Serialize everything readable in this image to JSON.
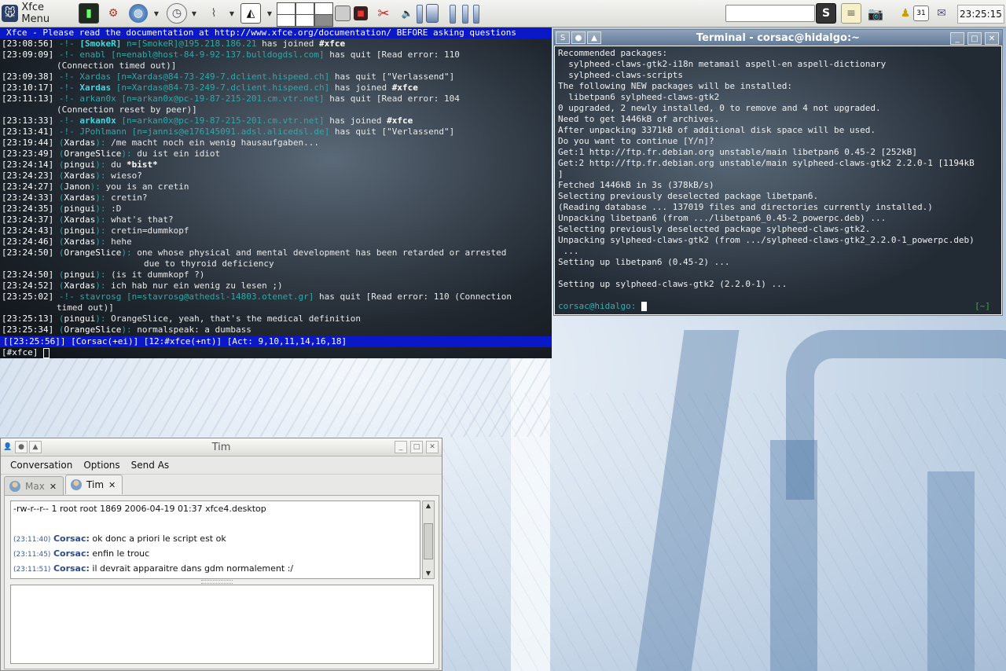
{
  "panel": {
    "menu_label": "Xfce Menu",
    "clock": "23:25:15",
    "icons": [
      "terminal-icon",
      "settings-manager-icon",
      "web-browser-icon",
      "clock-timer-icon",
      "mouse-icon",
      "inkscape-icon",
      "workspace-switcher",
      "window-list-icon",
      "screenshot-icon",
      "cut-icon",
      "mixer-icon",
      "battery-icon",
      "cpu-monitor-icon",
      "search-entry",
      "search-button-icon",
      "notes-icon",
      "camera-icon",
      "user-icon",
      "calendar-icon",
      "mail-icon"
    ]
  },
  "irc": {
    "topic": "Xfce - Please read the documentation at http://www.xfce.org/documentation/ BEFORE asking questions",
    "lines": [
      {
        "ts": "[23:08:56]",
        "kind": "join",
        "nick": "[SmokeR]",
        "host": "n=[SmokeR]@195.218.186.21",
        "msg": "has joined",
        "chan": "#xfce"
      },
      {
        "ts": "[23:09:09]",
        "kind": "quit",
        "nick": "enabl",
        "host": "[n=enabl@host-84-9-92-137.bulldogdsl.com]",
        "msg": "has quit [Read error: 110",
        "cont": "(Connection timed out)]"
      },
      {
        "ts": "[23:09:38]",
        "kind": "quit",
        "nick": "Xardas",
        "host": "[n=Xardas@84-73-249-7.dclient.hispeed.ch]",
        "msg": "has quit [\"Verlassend\"]"
      },
      {
        "ts": "[23:10:17]",
        "kind": "join",
        "nick": "Xardas",
        "host": "[n=Xardas@84-73-249-7.dclient.hispeed.ch]",
        "msg": "has joined",
        "chan": "#xfce"
      },
      {
        "ts": "[23:11:13]",
        "kind": "quit",
        "nick": "arkan0x",
        "host": "[n=arkan0x@pc-19-87-215-201.cm.vtr.net]",
        "msg": "has quit [Read error: 104",
        "cont": "(Connection reset by peer)]"
      },
      {
        "ts": "[23:13:33]",
        "kind": "join",
        "nick": "arkan0x",
        "host": "[n=arkan0x@pc-19-87-215-201.cm.vtr.net]",
        "msg": "has joined",
        "chan": "#xfce"
      },
      {
        "ts": "[23:13:41]",
        "kind": "quit",
        "nick": "JPohlmann",
        "host": "[n=jannis@e176145091.adsl.alicedsl.de]",
        "msg": "has quit [\"Verlassend\"]"
      },
      {
        "ts": "[23:19:44]",
        "kind": "msg",
        "nick": "Xardas",
        "text": "/me macht noch ein wenig hausaufgaben..."
      },
      {
        "ts": "[23:23:49]",
        "kind": "msg",
        "nick": "OrangeSlice",
        "text": "du ist ein idiot"
      },
      {
        "ts": "[23:24:14]",
        "kind": "msg",
        "nick": "pingui",
        "text": "du *bist*"
      },
      {
        "ts": "[23:24:23]",
        "kind": "msg",
        "nick": "Xardas",
        "text": "wieso?"
      },
      {
        "ts": "[23:24:27]",
        "kind": "msg",
        "nick": "Janon",
        "text": "you is an cretin"
      },
      {
        "ts": "[23:24:33]",
        "kind": "msg",
        "nick": "Xardas",
        "text": "cretin?"
      },
      {
        "ts": "[23:24:35]",
        "kind": "msg",
        "nick": "pingui",
        "text": ":D"
      },
      {
        "ts": "[23:24:37]",
        "kind": "msg",
        "nick": "Xardas",
        "text": "what's that?"
      },
      {
        "ts": "[23:24:43]",
        "kind": "msg",
        "nick": "pingui",
        "text": "cretin=dummkopf"
      },
      {
        "ts": "[23:24:46]",
        "kind": "msg",
        "nick": "Xardas",
        "text": "hehe"
      },
      {
        "ts": "[23:24:50]",
        "kind": "msg",
        "nick": "OrangeSlice",
        "text": "one whose physical and mental development has been retarded or arrested",
        "cont": "due to thyroid deficiency"
      },
      {
        "ts": "[23:24:50]",
        "kind": "msg",
        "nick": "pingui",
        "text": "(is it dummkopf ?)"
      },
      {
        "ts": "[23:24:52]",
        "kind": "msg",
        "nick": "Xardas",
        "text": "ich hab nur ein wenig zu lesen ;)"
      },
      {
        "ts": "[23:25:02]",
        "kind": "quit",
        "nick": "stavrosg",
        "host": "[n=stavrosg@athedsl-14803.otenet.gr]",
        "msg": "has quit [Read error: 110 (Connection",
        "cont": "timed out)]"
      },
      {
        "ts": "[23:25:13]",
        "kind": "msg",
        "nick": "pingui",
        "text": "OrangeSlice, yeah, that's the medical definition"
      },
      {
        "ts": "[23:25:34]",
        "kind": "msg",
        "nick": "OrangeSlice",
        "text": "normalspeak: a dumbass"
      }
    ],
    "status": "[[23:25:56]] [Corsac(+ei)] [12:#xfce(+nt)] [Act: 9,10,11,14,16,18]",
    "input_prompt": "[#xfce]"
  },
  "terminal": {
    "title": "Terminal - corsac@hidalgo:~",
    "lines": [
      "Recommended packages:",
      "  sylpheed-claws-gtk2-i18n metamail aspell-en aspell-dictionary",
      "  sylpheed-claws-scripts",
      "The following NEW packages will be installed:",
      "  libetpan6 sylpheed-claws-gtk2",
      "0 upgraded, 2 newly installed, 0 to remove and 4 not upgraded.",
      "Need to get 1446kB of archives.",
      "After unpacking 3371kB of additional disk space will be used.",
      "Do you want to continue [Y/n]?",
      "Get:1 http://ftp.fr.debian.org unstable/main libetpan6 0.45-2 [252kB]",
      "Get:2 http://ftp.fr.debian.org unstable/main sylpheed-claws-gtk2 2.2.0-1 [1194kB",
      "]",
      "Fetched 1446kB in 3s (378kB/s)",
      "Selecting previously deselected package libetpan6.",
      "(Reading database ... 137019 files and directories currently installed.)",
      "Unpacking libetpan6 (from .../libetpan6_0.45-2_powerpc.deb) ...",
      "Selecting previously deselected package sylpheed-claws-gtk2.",
      "Unpacking sylpheed-claws-gtk2 (from .../sylpheed-claws-gtk2_2.2.0-1_powerpc.deb)",
      " ...",
      "Setting up libetpan6 (0.45-2) ...",
      "",
      "Setting up sylpheed-claws-gtk2 (2.2.0-1) ...",
      ""
    ],
    "prompt_user": "corsac@hidalgo:",
    "prompt_dir": "[~]"
  },
  "chat": {
    "title": "Tim",
    "menu": [
      "Conversation",
      "Options",
      "Send As"
    ],
    "tabs": [
      {
        "label": "Max"
      },
      {
        "label": "Tim"
      }
    ],
    "history": [
      {
        "plain": "-rw-r--r-- 1 root root 1869 2006-04-19 01:37 xfce4.desktop"
      },
      {
        "time": "(23:11:40)",
        "nick": "Corsac:",
        "text": "ok donc a priori le script est ok"
      },
      {
        "time": "(23:11:45)",
        "nick": "Corsac:",
        "text": "enfin le trouc"
      },
      {
        "time": "(23:11:51)",
        "nick": "Corsac:",
        "text": "il devrait apparaitre dans gdm normalement :/"
      }
    ]
  }
}
